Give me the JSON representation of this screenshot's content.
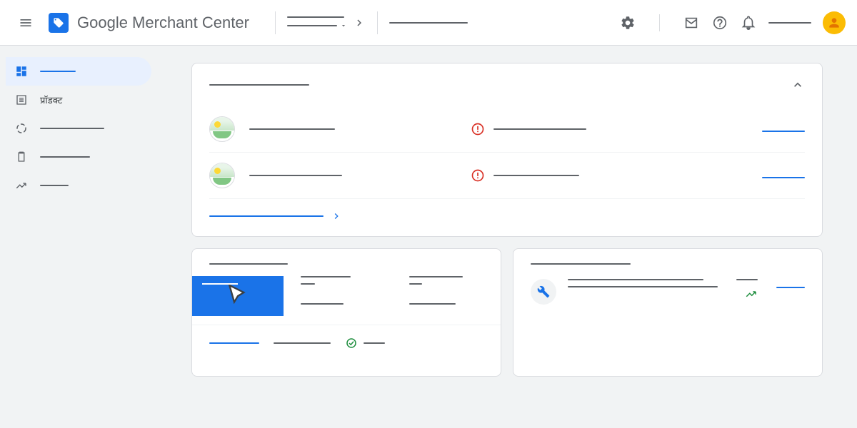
{
  "header": {
    "app_title": "Google Merchant Center"
  },
  "sidebar": {
    "items": [
      {
        "label": ""
      },
      {
        "label": "प्रॉडक्ट"
      },
      {
        "label": ""
      },
      {
        "label": ""
      },
      {
        "label": ""
      }
    ]
  }
}
